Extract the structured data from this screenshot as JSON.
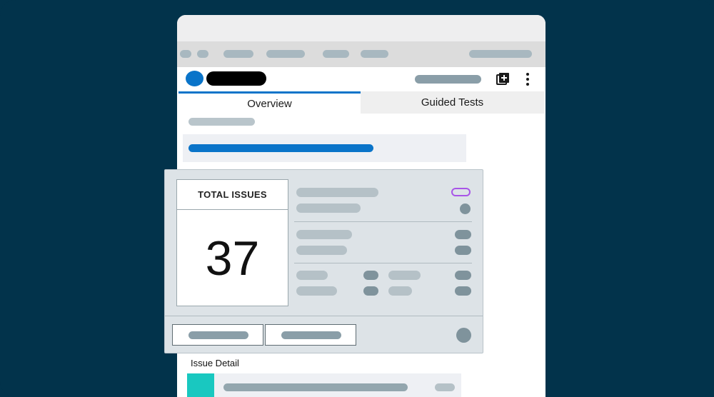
{
  "tabs": [
    {
      "label": "Overview",
      "active": true
    },
    {
      "label": "Guided Tests",
      "active": false
    }
  ],
  "summary": {
    "title": "TOTAL ISSUES",
    "value": "37"
  },
  "progress": {
    "fraction": 0.7
  },
  "section": {
    "issue_detail": "Issue Detail"
  },
  "colors": {
    "background": "#02334b",
    "accent": "#0a74c9",
    "badge_outline": "#a855e8",
    "teal": "#19c8c0"
  },
  "icons": {
    "add": "add-box-icon",
    "more": "more-vertical-icon",
    "avatar": "avatar"
  }
}
